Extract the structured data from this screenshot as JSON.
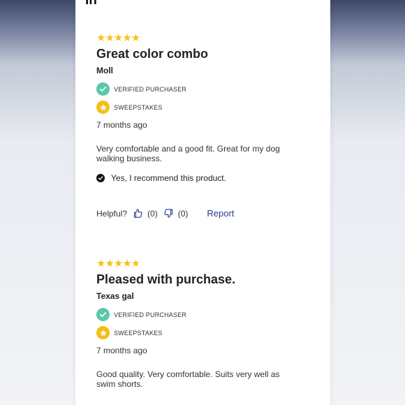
{
  "header": {
    "fragment": "In"
  },
  "reviews": [
    {
      "stars": "★★★★★",
      "title": "Great color combo",
      "author": "Moll",
      "badges": [
        "VERIFIED PURCHASER",
        "SWEEPSTAKES"
      ],
      "time": "7 months ago",
      "text": "Very comfortable and a good fit. Great for my dog walking business.",
      "recommend": "Yes, I recommend this product.",
      "helpful": {
        "label": "Helpful?",
        "up": "(0)",
        "down": "(0)",
        "report": "Report"
      }
    },
    {
      "stars": "★★★★★",
      "title": "Pleased with purchase.",
      "author": "Texas gal",
      "badges": [
        "VERIFIED PURCHASER",
        "SWEEPSTAKES"
      ],
      "time": "7 months ago",
      "text": "Good quality. Very comfortable. Suits very well as swim shorts."
    }
  ],
  "colors": {
    "star": "#f4c21a",
    "verified": "#5cc7aa",
    "sweepstakes": "#f3be18",
    "report": "#2a3a8a"
  },
  "icons": [
    "checkmark-icon",
    "star-icon",
    "thumbs-up-icon",
    "thumbs-down-icon"
  ]
}
